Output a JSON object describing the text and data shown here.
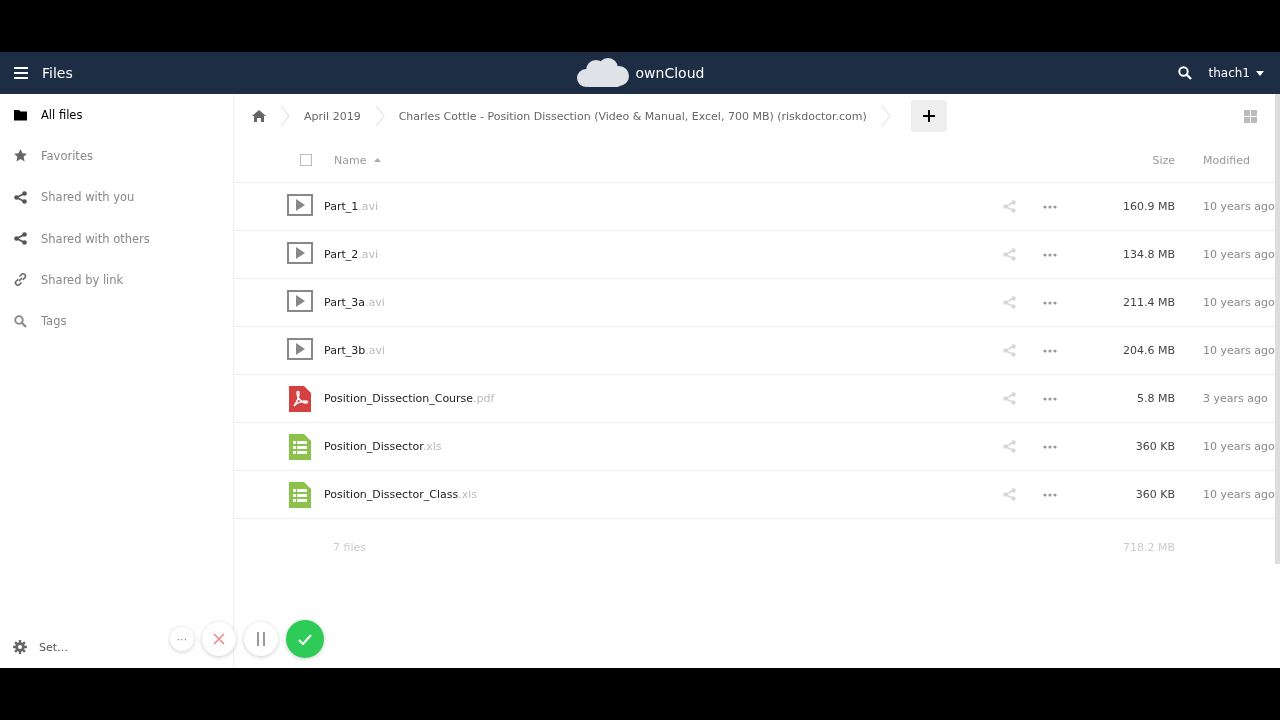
{
  "header": {
    "app_title": "Files",
    "brand": "ownCloud",
    "user": "thach1"
  },
  "sidebar": {
    "items": [
      {
        "label": "All files",
        "kind": "folder",
        "selected": true
      },
      {
        "label": "Favorites",
        "kind": "star",
        "selected": false
      },
      {
        "label": "Shared with you",
        "kind": "share",
        "selected": false
      },
      {
        "label": "Shared with others",
        "kind": "share",
        "selected": false
      },
      {
        "label": "Shared by link",
        "kind": "link",
        "selected": false
      },
      {
        "label": "Tags",
        "kind": "search",
        "selected": false
      }
    ],
    "settings": "Set…"
  },
  "breadcrumb": [
    "April 2019",
    "Charles Cottle - Position Dissection (Video & Manual, Excel, 700 MB) (riskdoctor.com)"
  ],
  "table": {
    "select_all": {
      "checked": false
    },
    "columns": {
      "name": "Name",
      "size": "Size",
      "modified": "Modified"
    },
    "rows": [
      {
        "kind": "video",
        "name": "Part_1",
        "ext": ".avi",
        "size": "160.9 MB",
        "modified": "10 years ago"
      },
      {
        "kind": "video",
        "name": "Part_2",
        "ext": ".avi",
        "size": "134.8 MB",
        "modified": "10 years ago"
      },
      {
        "kind": "video",
        "name": "Part_3a",
        "ext": ".avi",
        "size": "211.4 MB",
        "modified": "10 years ago"
      },
      {
        "kind": "video",
        "name": "Part_3b",
        "ext": ".avi",
        "size": "204.6 MB",
        "modified": "10 years ago"
      },
      {
        "kind": "pdf",
        "name": "Position_Dissection_Course",
        "ext": ".pdf",
        "size": "5.8 MB",
        "modified": "3 years ago"
      },
      {
        "kind": "sheet",
        "name": "Position_Dissector",
        "ext": ".xls",
        "size": "360 KB",
        "modified": "10 years ago"
      },
      {
        "kind": "sheet",
        "name": "Position_Dissector_Class",
        "ext": ".xls",
        "size": "360 KB",
        "modified": "10 years ago"
      }
    ],
    "summary": {
      "count": "7 files",
      "total": "718.2 MB"
    }
  },
  "recorder": [
    {
      "kind": "more",
      "label": "···"
    },
    {
      "kind": "cancel"
    },
    {
      "kind": "pause"
    },
    {
      "kind": "done"
    }
  ]
}
